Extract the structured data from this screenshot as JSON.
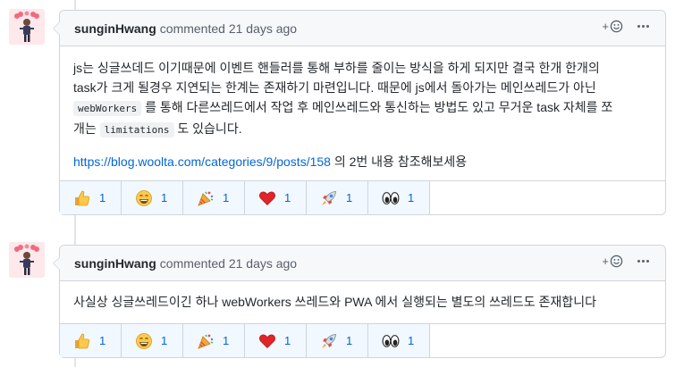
{
  "comments": [
    {
      "author": "sunginHwang",
      "meta": "commented 21 days ago",
      "line1": "js는 싱글쓰데드 이기때문에 이벤트 핸들러를 통해 부하를 줄이는 방식을 하게 되지만 결국 한개 한개의",
      "line2": "task가 크게 될경우 지연되는 한계는 존재하기 마련입니다. 때문에 js에서 돌아가는 메인쓰레드가 아닌",
      "code1": "webWorkers",
      "line3b": "를 통해 다른쓰레드에서 작업 후 메인쓰레드와 통신하는 방법도 있고 무거운 task 자체를 쪼",
      "line4a": "개는",
      "code2": "limitations",
      "line4b": "도 있습니다.",
      "link": "https://blog.woolta.com/categories/9/posts/158",
      "link_suffix": " 의 2번 내용 참조해보세용",
      "reactions": [
        {
          "icon": "thumbs-up",
          "count": "1"
        },
        {
          "icon": "laugh",
          "count": "1"
        },
        {
          "icon": "hooray",
          "count": "1"
        },
        {
          "icon": "heart",
          "count": "1"
        },
        {
          "icon": "rocket",
          "count": "1"
        },
        {
          "icon": "eyes",
          "count": "1"
        }
      ]
    },
    {
      "author": "sunginHwang",
      "meta": "commented 21 days ago",
      "text": "사실상 싱글쓰레드이긴 하나 webWorkers 쓰레드와 PWA 에서 실행되는 별도의 쓰레드도 존재합니다",
      "reactions": [
        {
          "icon": "thumbs-up",
          "count": "1"
        },
        {
          "icon": "laugh",
          "count": "1"
        },
        {
          "icon": "hooray",
          "count": "1"
        },
        {
          "icon": "heart",
          "count": "1"
        },
        {
          "icon": "rocket",
          "count": "1"
        },
        {
          "icon": "eyes",
          "count": "1"
        }
      ]
    }
  ]
}
